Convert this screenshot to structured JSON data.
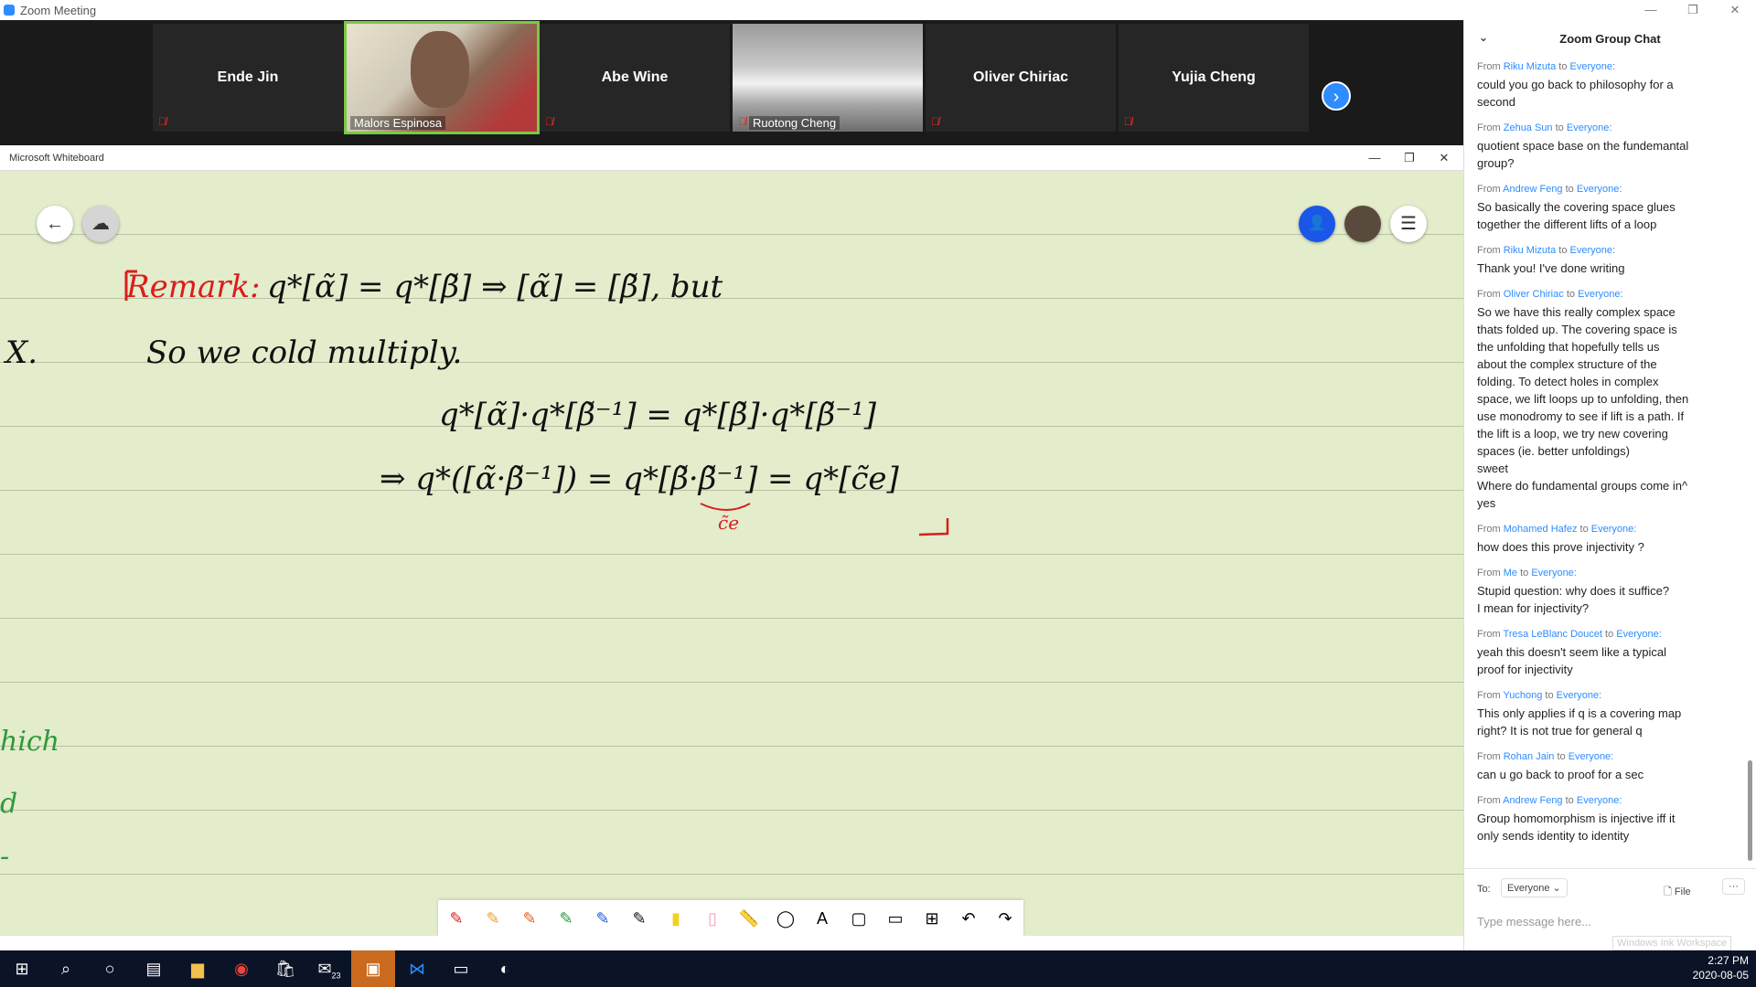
{
  "window": {
    "title": "Zoom Meeting"
  },
  "gallery": {
    "participants": [
      {
        "name": "Ende Jin"
      },
      {
        "name": "Malors Espinosa"
      },
      {
        "name": "Abe Wine"
      },
      {
        "name": "Ruotong Cheng"
      },
      {
        "name": "Oliver Chiriac"
      },
      {
        "name": "Yujia Cheng"
      }
    ]
  },
  "whiteboard": {
    "title": "Microsoft Whiteboard",
    "text": {
      "remark": "Remark:",
      "line1": "q*[α̃] = q*[β̃]  ⇒  [α̃] = [β̃],  but",
      "x": "X.",
      "so": "So    we  cold  multiply.",
      "eq1": "q*[α̃]·q*[β̃⁻¹]  =  q*[β̃]·q*[β̃⁻¹]",
      "eq2": "⇒   q*([α̃·β̃⁻¹]) = q*[β̃·β̃⁻¹] = q*[c̃e]",
      "ce": "c̃e",
      "margin1": "hich",
      "margin2": "d",
      "margin3": "-"
    }
  },
  "chat": {
    "header": "Zoom Group Chat",
    "messages": [
      {
        "from": "Riku Mizuta",
        "to": "Everyone:",
        "lines": [
          "could you go back to philosophy for a",
          "second"
        ]
      },
      {
        "from": "Zehua Sun",
        "to": "Everyone:",
        "lines": [
          "quotient space base on the fundemantal",
          "group?"
        ]
      },
      {
        "from": "Andrew Feng",
        "to": "Everyone:",
        "lines": [
          "So basically the covering space glues",
          "together the different lifts of a loop"
        ]
      },
      {
        "from": "Riku Mizuta",
        "to": "Everyone:",
        "lines": [
          "Thank you! I've done writing"
        ]
      },
      {
        "from": "Oliver Chiriac",
        "to": "Everyone:",
        "lines": [
          "So we have this really complex space",
          "thats folded up. The covering space is",
          "the unfolding that hopefully tells us",
          "about the complex structure of the",
          "folding. To detect holes in complex",
          "space, we lift loops up to unfolding, then",
          "use monodromy to see if lift is a path. If",
          "the lift is a loop, we try new covering",
          "spaces (ie. better unfoldings)",
          "sweet",
          "Where do fundamental groups come in^",
          "yes"
        ]
      },
      {
        "from": "Mohamed Hafez",
        "to": "Everyone:",
        "lines": [
          "how does this prove injectivity ?"
        ]
      },
      {
        "from": "Me",
        "to": "Everyone:",
        "lines": [
          "Stupid question: why does it suffice?",
          "I mean for injectivity?"
        ]
      },
      {
        "from": "Tresa LeBlanc Doucet",
        "to": "Everyone:",
        "lines": [
          "yeah this doesn't seem like a typical",
          "proof for injectivity"
        ]
      },
      {
        "from": "Yuchong",
        "to": "Everyone:",
        "lines": [
          "This only applies if q is a covering map",
          "right? It is not true for general q"
        ]
      },
      {
        "from": "Rohan Jain",
        "to": "Everyone:",
        "lines": [
          "can u go back to proof for a sec"
        ]
      },
      {
        "from": "Andrew Feng",
        "to": "Everyone:",
        "lines": [
          "Group homomorphism is injective iff it",
          "only sends identity to identity"
        ]
      }
    ],
    "from_prefix": "From",
    "to_word": "to",
    "to_label": "To:",
    "recipient": "Everyone",
    "file_label": "File",
    "more_label": "···",
    "input_placeholder": "Type message here..."
  },
  "ink_workspace": "Windows Ink Workspace",
  "taskbar": {
    "time": "2:27 PM",
    "date": "2020-08-05",
    "mail_badge": "23"
  },
  "colors": {
    "zoom_blue": "#2d8cff",
    "whiteboard_bg": "#e3eccb",
    "ink_red": "#d81e1e",
    "ink_green": "#2e9a3c"
  }
}
